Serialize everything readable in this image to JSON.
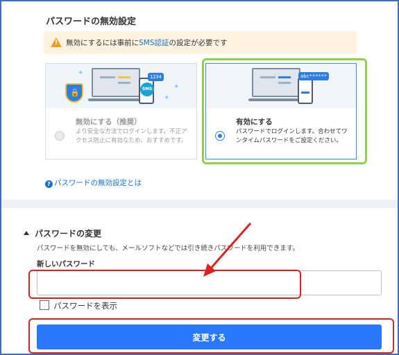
{
  "disable_section": {
    "title": "パスワードの無効設定",
    "warning_prefix": "無効にするには事前に",
    "warning_link": "SMS認証",
    "warning_suffix": "の設定が必要です"
  },
  "options": [
    {
      "title": "無効にする（推奨）",
      "description": "より安全な方法でログインします。不正アクセス防止に有効なため、おすすめです。",
      "phone_code": "1234",
      "badge": "SMS",
      "selected": false
    },
    {
      "title": "有効にする",
      "description": "パスワードでログインします。合わせてワンタイムパスワードをご設定ください。",
      "phone_code": "abc******",
      "selected": true
    }
  ],
  "help_link": "パスワードの無効設定とは",
  "change_section": {
    "title": "パスワードの変更",
    "description": "パスワードを無効にしても、メールソフトなどでは引き続きパスワードを利用できます。",
    "field_label": "新しいパスワード",
    "input_value": "",
    "show_password_label": "パスワードを表示",
    "submit_label": "変更する"
  },
  "colors": {
    "accent": "#2979ff",
    "highlight_green": "#8ed14a",
    "annotation_red": "#e02020"
  }
}
